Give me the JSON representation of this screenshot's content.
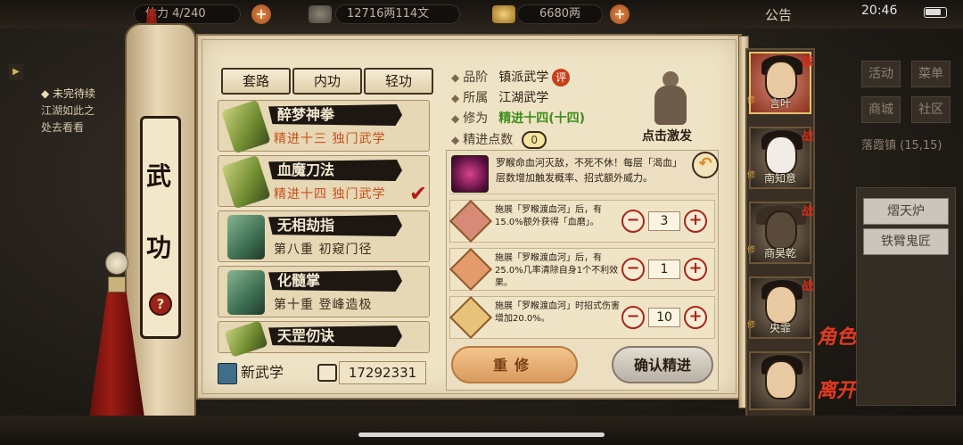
{
  "status": {
    "time": "20:46"
  },
  "topbar": {
    "stamina_label": "体力",
    "stamina_value": "4/240",
    "silver": "12716两114文",
    "gold": "6680两",
    "notice": "公告"
  },
  "quest": {
    "title": "◆ 未完待续",
    "line1": "江湖如此之",
    "line2": "处去看看"
  },
  "panel": {
    "title_char_1": "武",
    "title_char_2": "功",
    "help": "?",
    "tabs": [
      "套路",
      "内功",
      "轻功"
    ],
    "skills": [
      {
        "name": "醉梦神拳",
        "sub": "精进十三  独门武学"
      },
      {
        "name": "血魔刀法",
        "sub": "精进十四  独门武学"
      },
      {
        "name": "无相劫指",
        "sub": "第八重    初窥门径"
      },
      {
        "name": "化髓掌",
        "sub": "第十重    登峰造极"
      },
      {
        "name": "天罡仞诀",
        "sub": ""
      }
    ],
    "new_skill": "新武学",
    "points": "17292331"
  },
  "detail": {
    "grade_label": "品阶",
    "grade_value": "镇派武学",
    "rate_badge": "评",
    "belong_label": "所属",
    "belong_value": "江湖武学",
    "cultivation_label": "修为",
    "cultivation_value": "精进十四(十四)",
    "points_label": "精进点数",
    "points_value": "0",
    "activate_label": "点击激发",
    "effect_desc": "罗睺命血河灭敌，不死不休！每层「渴血」层数增加触发概率、招式额外威力。",
    "back_icon": "↶",
    "sub_effects": [
      {
        "text": "施展「罗睺渡血河」后，有15.0%额外获得「血磨」。",
        "value": "3"
      },
      {
        "text": "施展「罗睺渡血河」后，有25.0%几率清除自身1个不利效果。",
        "value": "1"
      },
      {
        "text": "施展「罗睺渡血河」时招式伤害增加20.0%。",
        "value": "10"
      }
    ],
    "minus": "−",
    "plus": "+",
    "reset_label": "重修",
    "confirm_label": "确认精进"
  },
  "characters": [
    {
      "name": "言叶",
      "battle": "战",
      "cultivate": "修"
    },
    {
      "name": "南知意",
      "battle": "战",
      "cultivate": "修"
    },
    {
      "name": "商昊乾",
      "battle": "战",
      "cultivate": "修"
    },
    {
      "name": "央霏",
      "battle": "战",
      "cultivate": "修"
    },
    {
      "name": "",
      "battle": "",
      "cultivate": ""
    }
  ],
  "side_tags": {
    "role": "角色",
    "leave": "离开"
  },
  "right_menu": {
    "activity": "活动",
    "menu": "菜单",
    "shop": "商城",
    "community": "社区",
    "location": "落霞镇 (15,15)",
    "btn1": "熠天炉",
    "btn2": "铁臂鬼匠"
  },
  "colors": {
    "accent_red": "#d42a1a",
    "paper": "#efe3c6",
    "ink": "#2b1d12",
    "green": "#3e8d1c"
  }
}
